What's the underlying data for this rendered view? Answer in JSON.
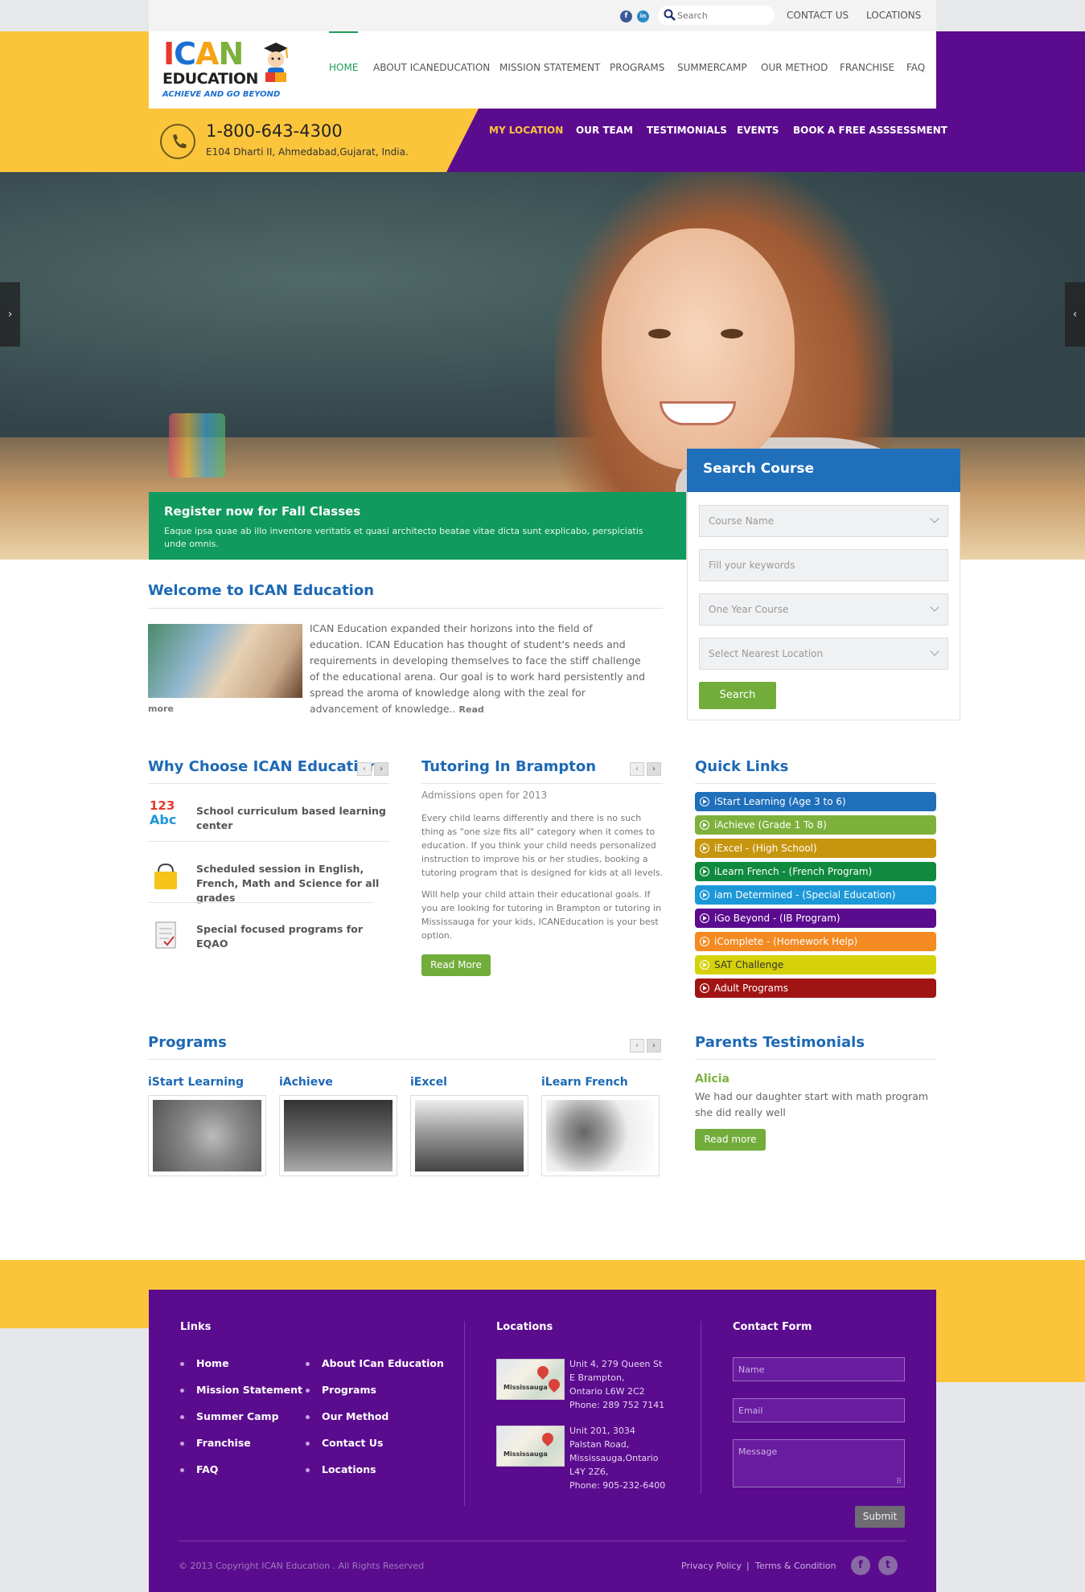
{
  "topbar": {
    "social": [
      "f",
      "in"
    ],
    "search_placeholder": "Search",
    "links": [
      "CONTACT US",
      "LOCATIONS"
    ]
  },
  "logo": {
    "line1": "ICAN",
    "line2": "EDUCATION",
    "tagline": "ACHIEVE AND GO BEYOND"
  },
  "main_nav": [
    "HOME",
    "ABOUT ICANEDUCATION",
    "MISSION STATEMENT",
    "PROGRAMS",
    "SUMMERCAMP",
    "OUR METHOD",
    "FRANCHISE",
    "FAQ"
  ],
  "contact": {
    "phone": "1-800-643-4300",
    "address": "E104 Dharti II, Ahmedabad,Gujarat, India."
  },
  "sub_nav": [
    "MY LOCATION",
    "OUR TEAM",
    "TESTIMONIALS",
    "EVENTS",
    "BOOK A FREE ASSSESSMENT"
  ],
  "hero": {
    "prev": "›",
    "next": "‹",
    "register_title": "Register now for Fall Classes",
    "register_text": "Eaque ipsa quae ab illo inventore veritatis et quasi architecto beatae vitae dicta sunt explicabo, perspiciatis unde omnis."
  },
  "search_course": {
    "title": "Search Course",
    "course_name": "Course Name",
    "keywords_placeholder": "Fill your keywords",
    "duration": "One Year Course",
    "location": "Select Nearest Location",
    "button": "Search"
  },
  "welcome": {
    "title": "Welcome to ICAN Education",
    "text": "ICAN Education expanded their horizons into the field of education. ICAN Education has thought of student's needs and requirements in developing themselves to face the stiff challenge of the educational arena. Our goal is to work hard persistently and spread the aroma of knowledge along with the zeal for advancement of knowledge..",
    "read_more_1": "Read",
    "read_more_2": "more"
  },
  "why": {
    "title": "Why Choose ICAN Education",
    "items": [
      "School curriculum based learning center",
      "Scheduled session in English, French, Math and Science for all grades",
      "Special focused programs for EQAO"
    ],
    "icon_text": [
      "123",
      "Abc"
    ]
  },
  "tutoring": {
    "title": "Tutoring In Brampton",
    "subtitle": "Admissions open for 2013",
    "p1": "Every child learns differently and there is no such thing as \"one size fits all\" category when it comes to education. If you think your child needs personalized instruction to improve his or her studies, booking a tutoring program that is designed for kids at all levels.",
    "p2": "Will help your child attain their educational goals. If you are looking for tutoring in Brampton or tutoring in Mississauga for your kids, ICANEducation is your best option.",
    "button": "Read More"
  },
  "quick_links": {
    "title": "Quick Links",
    "items": [
      {
        "label": "iStart Learning (Age 3 to 6)",
        "color": "#1f6fbb"
      },
      {
        "label": "iAchieve (Grade 1 To 8)",
        "color": "#7db13c"
      },
      {
        "label": "iExcel - (High School)",
        "color": "#c7960f"
      },
      {
        "label": "iLearn French - (French Program)",
        "color": "#0f8a3f"
      },
      {
        "label": "iam Determined - (Special Education)",
        "color": "#1c98d8"
      },
      {
        "label": "iGo Beyond - (IB Program)",
        "color": "#5b0c8e"
      },
      {
        "label": "iComplete - (Homework Help)",
        "color": "#f38a22"
      },
      {
        "label": "SAT Challenge",
        "color": "#d5d20a"
      },
      {
        "label": "Adult Programs",
        "color": "#a11414"
      }
    ]
  },
  "programs": {
    "title": "Programs",
    "items": [
      "iStart Learning",
      "iAchieve",
      "iExcel",
      "iLearn French"
    ]
  },
  "testimonials": {
    "title": "Parents Testimonials",
    "name": "Alicia",
    "text": "We had our daughter start with math program she did really well",
    "button": "Read more"
  },
  "footer": {
    "links_title": "Links",
    "links_col1": [
      "Home",
      "Mission Statement",
      "Summer Camp",
      "Franchise",
      "FAQ"
    ],
    "links_col2": [
      "About ICan Education",
      "Programs",
      "Our Method",
      "Contact Us",
      "Locations"
    ],
    "locations_title": "Locations",
    "locations": [
      {
        "map_label": "Mississauga",
        "lines": [
          "Unit 4, 279 Queen St",
          "E Brampton,",
          "Ontario L6W 2C2",
          "Phone: 289 752 7141"
        ]
      },
      {
        "map_label": "Mississauga",
        "lines": [
          "Unit 201, 3034",
          "Palstan Road,",
          "Mississauga,Ontario",
          "L4Y 2Z6,",
          "Phone: 905-232-6400"
        ]
      }
    ],
    "contact_title": "Contact Form",
    "name_placeholder": "Name",
    "email_placeholder": "Email",
    "message_placeholder": "Message",
    "submit": "Submit",
    "copyright": "© 2013 Copyright ICAN Education . All Rights Reserved",
    "privacy": "Privacy Policy",
    "separator": "|",
    "terms": "Terms & Condition",
    "social": [
      "f",
      "t"
    ]
  },
  "colors": {
    "yellow": "#fbc53b",
    "purple": "#5b0c8e",
    "green": "#109a5e",
    "blue": "#1f6fbb",
    "button_green": "#72ad3b"
  }
}
